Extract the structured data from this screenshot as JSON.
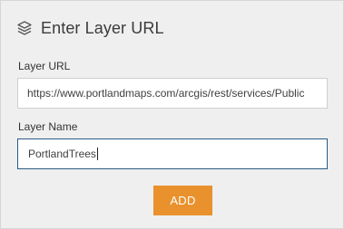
{
  "header": {
    "icon": "layers-icon",
    "title": "Enter Layer URL"
  },
  "form": {
    "url_label": "Layer URL",
    "url_value": "https://www.portlandmaps.com/arcgis/rest/services/Public",
    "name_label": "Layer Name",
    "name_value": "PortlandTrees"
  },
  "actions": {
    "add_label": "ADD"
  },
  "colors": {
    "panel_background": "#efefef",
    "accent_button": "#e8912d",
    "focused_border": "#2a5a85"
  }
}
